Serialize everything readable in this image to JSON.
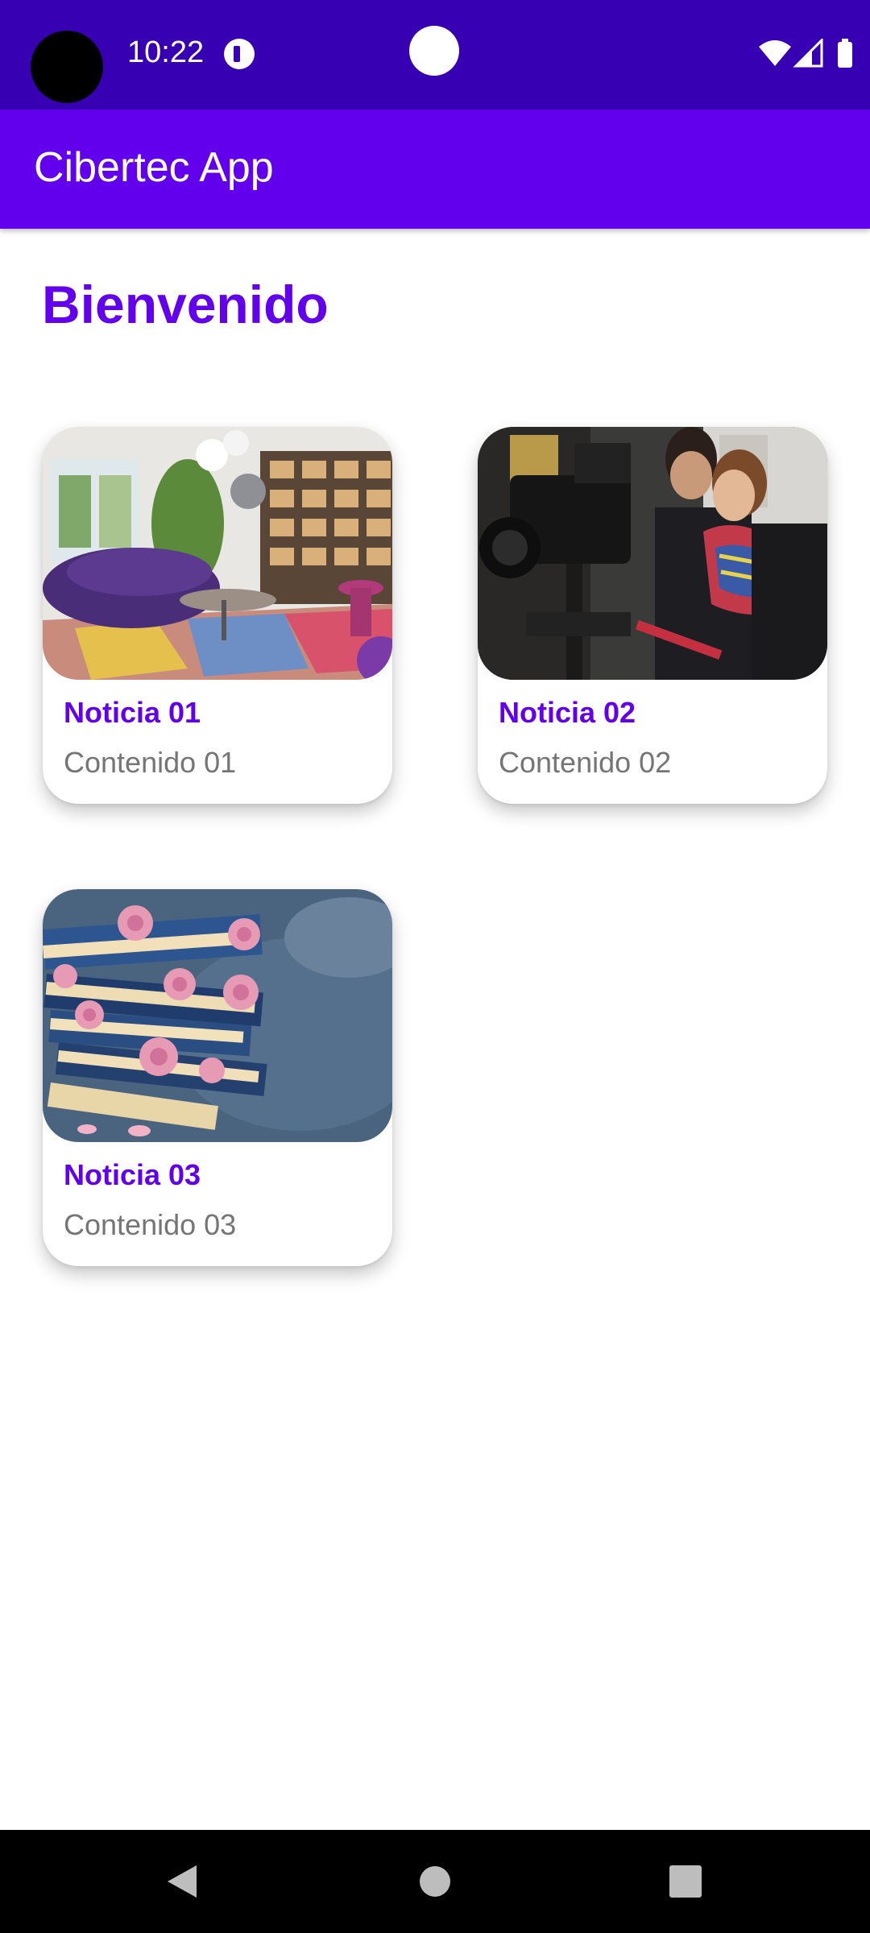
{
  "status_bar": {
    "time": "10:22",
    "icons": [
      "dnd-icon",
      "wifi-icon",
      "signal-icon",
      "battery-icon"
    ]
  },
  "app_bar": {
    "title": "Cibertec App",
    "color": "#6200EE"
  },
  "main": {
    "heading": "Bienvenido",
    "cards": [
      {
        "title": "Noticia 01",
        "content": "Contenido 01",
        "image": "living-room-photo"
      },
      {
        "title": "Noticia 02",
        "content": "Contenido 02",
        "image": "film-camera-crew-photo"
      },
      {
        "title": "Noticia 03",
        "content": "Contenido 03",
        "image": "books-and-roses-photo"
      }
    ]
  },
  "nav_bar": {
    "icons": [
      "back-icon",
      "home-icon",
      "recents-icon"
    ]
  },
  "colors": {
    "status_bar": "#3700B3",
    "primary": "#6200EE",
    "content_text": "#757575"
  }
}
